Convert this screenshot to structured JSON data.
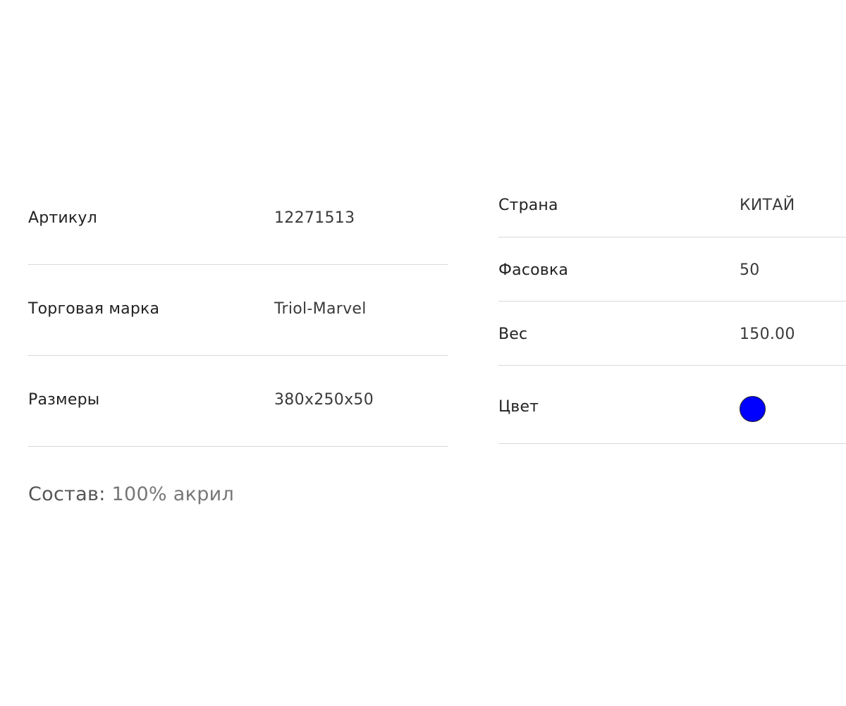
{
  "specs_left": [
    {
      "label": "Артикул",
      "value": "12271513"
    },
    {
      "label": "Торговая марка",
      "value": "Triol-Marvel"
    },
    {
      "label": "Размеры",
      "value": "380x250x50"
    }
  ],
  "specs_right": [
    {
      "label": "Страна",
      "value": "КИТАЙ"
    },
    {
      "label": "Фасовка",
      "value": "50"
    },
    {
      "label": "Вес",
      "value": "150.00"
    },
    {
      "label": "Цвет",
      "swatch_color": "#0000ff"
    }
  ],
  "composition": {
    "label": "Состав:",
    "value": "100% акрил"
  }
}
